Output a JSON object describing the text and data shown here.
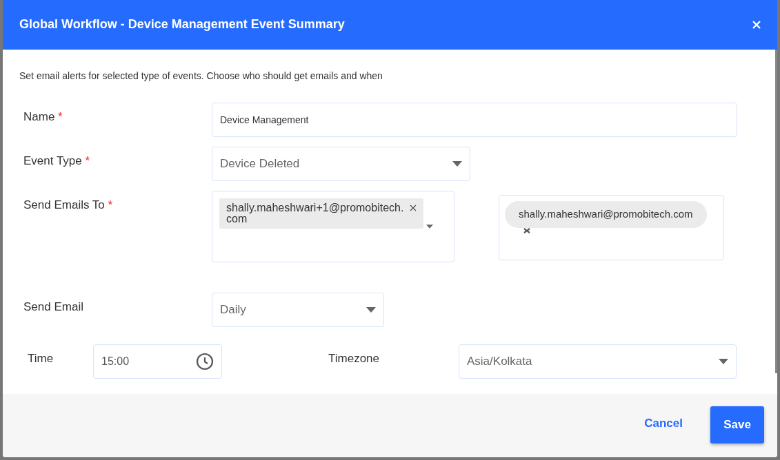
{
  "dialog": {
    "title": "Global Workflow - Device Management Event Summary"
  },
  "description": "Set email alerts for selected type of events. Choose who should get emails and when",
  "fields": [
    {
      "label": "Name",
      "required_mark": "*",
      "kind": "text",
      "value": "Device Management"
    },
    {
      "label": "Event Type",
      "required_mark": "*",
      "kind": "select",
      "value": "Device Deleted"
    },
    {
      "label": "Send Emails To",
      "required_mark": "*",
      "kind": "tags",
      "tags": [
        "shally.maheshwari+1@promobitech.com"
      ],
      "extra_tags": [
        "shally.maheshwari@promobitech.com"
      ]
    },
    {
      "label": "Send Email",
      "kind": "select",
      "value": "Daily"
    }
  ],
  "time": {
    "label": "Time",
    "value": "15:00"
  },
  "timezone": {
    "label": "Timezone",
    "value": "Asia/Kolkata"
  },
  "buttons": [
    {
      "label": "Cancel",
      "kind": "link"
    },
    {
      "label": "Save",
      "kind": "primary"
    }
  ]
}
